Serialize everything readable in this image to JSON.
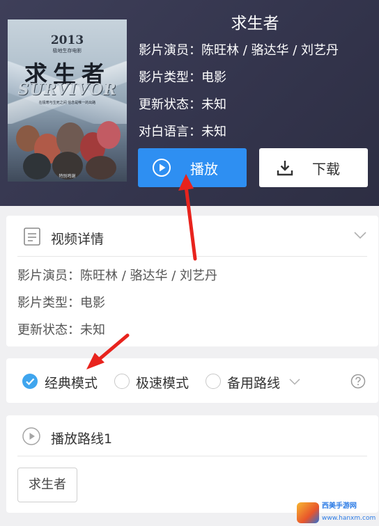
{
  "header": {
    "title": "求生者",
    "info": [
      "影片演员：陈旺林 / 骆达华 / 刘艺丹",
      "影片类型：电影",
      "更新状态：未知",
      "对白语言：未知"
    ],
    "play_label": "播放",
    "download_label": "下载",
    "accent_color": "#2e8ff2"
  },
  "poster": {
    "year": "2013",
    "subtitle": "极地生存电影",
    "title_cn": "求生者",
    "title_en": "SURVIVOR",
    "tagline": "在极寒与生死之间 信念是唯一的出路",
    "credit": "特别鸣谢"
  },
  "details": {
    "title": "视频详情",
    "lines": [
      "影片演员：陈旺林 / 骆达华 / 刘艺丹",
      "影片类型：电影",
      "更新状态：未知"
    ]
  },
  "modes": {
    "items": [
      {
        "label": "经典模式",
        "checked": true
      },
      {
        "label": "极速模式",
        "checked": false
      },
      {
        "label": "备用路线",
        "checked": false
      }
    ],
    "check_color": "#3fa5ee"
  },
  "route": {
    "title": "播放路线1",
    "episodes": [
      "求生者"
    ]
  },
  "watermark": {
    "site": "西美手游网",
    "url": "www.hanxm.com"
  },
  "annotation_color": "#e8231d"
}
